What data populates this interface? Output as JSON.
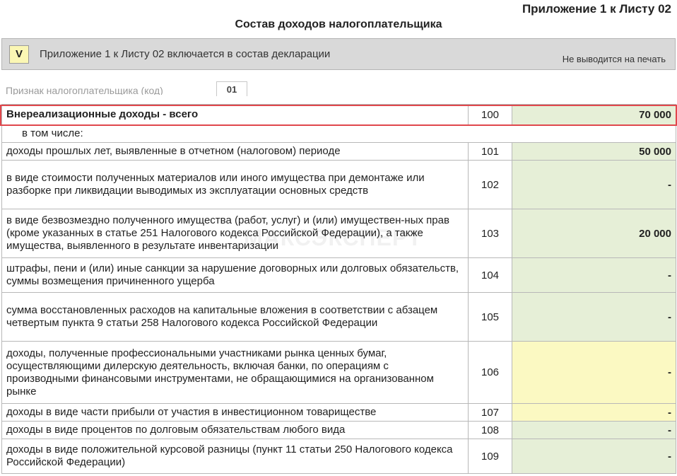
{
  "header": {
    "appendix_title": "Приложение 1 к Листу 02",
    "form_title": "Состав доходов налогоплательщика"
  },
  "include_bar": {
    "checkbox_value": "V",
    "label": "Приложение 1 к Листу 02 включается в состав декларации",
    "no_print_label": "Не выводится на печать"
  },
  "taxpayer_sign": {
    "label": "Признак налогоплательщика (код)",
    "code": "01"
  },
  "watermark": "МАКСЭКСПЕРТ",
  "rows": [
    {
      "desc": "Внереализационные доходы - всего",
      "code": "100",
      "value": "70 000",
      "fill": "#e6efd7"
    },
    {
      "desc": "в том числе:",
      "code": "",
      "value": ""
    },
    {
      "desc": "доходы прошлых лет, выявленные в отчетном (налоговом) периоде",
      "code": "101",
      "value": "50 000",
      "fill": "#e6efd7"
    },
    {
      "desc": "в виде стоимости полученных материалов или иного имущества при демонтаже или разборке при ликвидации выводимых из эксплуатации основных средств",
      "code": "102",
      "value": "-",
      "fill": "#e6efd7"
    },
    {
      "desc": "в виде безвозмездно полученного имущества (работ, услуг) и (или) имуществен-ных прав (кроме указанных в статье 251 Налогового кодекса Российской Федерации), а также имущества, выявленного в результате инвентаризации",
      "code": "103",
      "value": "20 000",
      "fill": "#e6efd7"
    },
    {
      "desc": "штрафы, пени и (или) иные санкции за нарушение договорных или долговых обязательств, суммы возмещения причиненного ущерба",
      "code": "104",
      "value": "-",
      "fill": "#e6efd7"
    },
    {
      "desc": "сумма восстановленных расходов на капитальные вложения в соответствии с абзацем четвертым пункта 9 статьи 258 Налогового кодекса Российской Федерации",
      "code": "105",
      "value": "-",
      "fill": "#e6efd7"
    },
    {
      "desc": "доходы, полученные профессиональными участниками рынка ценных бумаг, осуществляющими дилерскую деятельность, включая банки, по операциям с производными финансовыми инструментами, не обращающимися на организованном рынке",
      "code": "106",
      "value": "-",
      "fill": "#fbf9c2"
    },
    {
      "desc": "доходы в виде части прибыли от участия в инвестиционном товариществе",
      "code": "107",
      "value": "-",
      "fill": "#fbf9c2"
    },
    {
      "desc": "доходы в виде процентов по долговым обязательствам любого вида",
      "code": "108",
      "value": "-",
      "fill": "#e6efd7"
    },
    {
      "desc": "доходы в виде положительной курсовой разницы (пункт 11 статьи 250 Налогового кодекса Российской Федерации)",
      "code": "109",
      "value": "-",
      "fill": "#e6efd7"
    }
  ]
}
